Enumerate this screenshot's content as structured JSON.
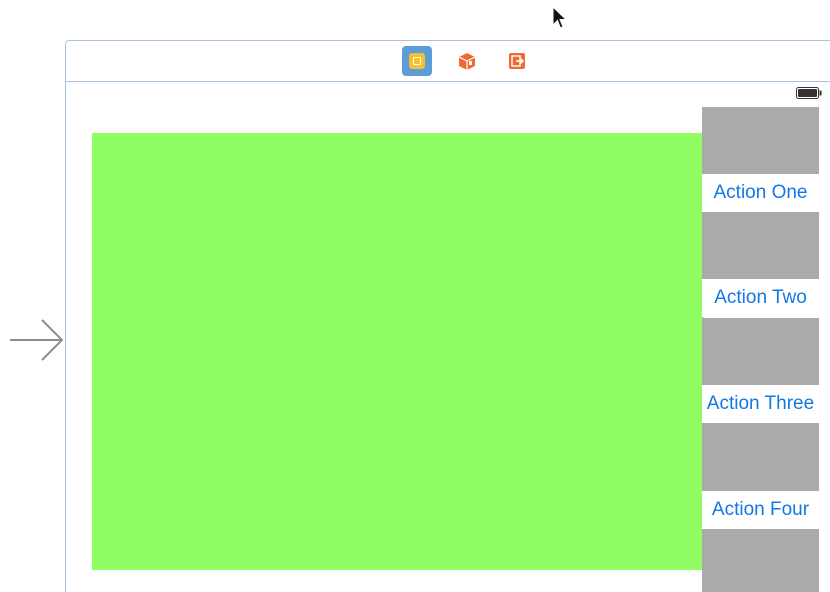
{
  "scene": {
    "dock_icons": [
      {
        "icon": "view-controller-icon",
        "color": "#f5c12e",
        "selected": true
      },
      {
        "icon": "first-responder-icon",
        "color": "#f06a35",
        "selected": false
      },
      {
        "icon": "exit-icon",
        "color": "#f06a35",
        "selected": false
      }
    ],
    "view": {
      "background_color": "#90fe63"
    },
    "actions": [
      {
        "label": "Action One"
      },
      {
        "label": "Action Two"
      },
      {
        "label": "Action Three"
      },
      {
        "label": "Action Four"
      }
    ],
    "colors": {
      "action_text": "#1278e5",
      "placeholder_gray": "#aaaaaa",
      "frame_border": "#a9c2e0"
    }
  }
}
